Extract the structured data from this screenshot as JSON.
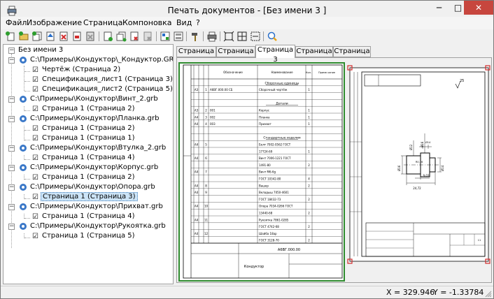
{
  "window": {
    "title": "Печать документов - [Без имени 3 ]"
  },
  "menu": [
    "Файл",
    "Изображение",
    "Страница",
    "Компоновка",
    "Вид",
    "?"
  ],
  "tree": {
    "root": "Без имени 3",
    "files": [
      {
        "path": "C:\\Примеры\\Кондуктор\\_Кондуктор.GRB",
        "pages": [
          "Чертёж (Страница 2)",
          "Спецификация_лист1 (Страница 3)",
          "Спецификация_лист2 (Страница 5)"
        ]
      },
      {
        "path": "C:\\Примеры\\Кондуктор\\Винт_2.grb",
        "pages": [
          "Страница 1 (Страница 2)"
        ]
      },
      {
        "path": "C:\\Примеры\\Кондуктор\\Планка.grb",
        "pages": [
          "Страница 1 (Страница 2)",
          "Страница 1 (Страница 1)"
        ]
      },
      {
        "path": "C:\\Примеры\\Кондуктор\\Втулка_2.grb",
        "pages": [
          "Страница 1 (Страница 4)"
        ]
      },
      {
        "path": "C:\\Примеры\\Кондуктор\\Корпус.grb",
        "pages": [
          "Страница 1 (Страница 2)"
        ]
      },
      {
        "path": "C:\\Примеры\\Кондуктор\\Опора.grb",
        "pages": [
          "Страница 1 (Страница 3)"
        ]
      },
      {
        "path": "C:\\Примеры\\Кондуктор\\Прихват.grb",
        "pages": [
          "Страница 1 (Страница 4)"
        ]
      },
      {
        "path": "C:\\Примеры\\Кондуктор\\Рукоятка.grb",
        "pages": [
          "Страница 1 (Страница 5)"
        ]
      }
    ],
    "selected_label": "Страница 1 (Страница 3)"
  },
  "tabs": [
    "Страница 1",
    "Страница 2",
    "Страница 3",
    "Страница 4",
    "Страница 5"
  ],
  "active_tab": "Страница 3",
  "spec_sheet": {
    "headers": [
      "Обозначение",
      "Наименование",
      "Кол.",
      "Приме-чание"
    ],
    "sections": [
      "Сборочные единицы",
      "Детали",
      "Стандартные изделия"
    ],
    "rows": [
      {
        "f": "A3",
        "p": "1",
        "d": "А6ВГ.000.00 СБ",
        "n": "Сборочный чертёж",
        "q": "1"
      },
      {
        "f": "A3",
        "p": "2",
        "d": "001",
        "n": "Корпус",
        "q": "1"
      },
      {
        "f": "A4",
        "p": "3",
        "d": "002",
        "n": "Планка",
        "q": "1"
      },
      {
        "f": "A4",
        "p": "4",
        "d": "003",
        "n": "Прихват",
        "q": "1"
      },
      {
        "f": "A4",
        "p": "5",
        "d": "",
        "n": "Болт 7002-0562 ГОСТ",
        "q": ""
      },
      {
        "f": "",
        "p": "",
        "d": "",
        "n": "17724-69",
        "q": "1"
      },
      {
        "f": "A4",
        "p": "6",
        "d": "",
        "n": "Винт 7006-1221 ГОСТ",
        "q": ""
      },
      {
        "f": "",
        "p": "",
        "d": "",
        "n": "1491-80",
        "q": "2"
      },
      {
        "f": "A4",
        "p": "7",
        "d": "",
        "n": "Винт М6-6g",
        "q": ""
      },
      {
        "f": "",
        "p": "",
        "d": "",
        "n": "ГОСТ 10342-80",
        "q": "4"
      },
      {
        "f": "A4",
        "p": "8",
        "d": "",
        "n": "Вашер",
        "q": "2"
      },
      {
        "f": "A4",
        "p": "9",
        "d": "",
        "n": "Вкладыш 7050-4601",
        "q": ""
      },
      {
        "f": "",
        "p": "",
        "d": "",
        "n": "ГОСТ 18432-73",
        "q": "2"
      },
      {
        "f": "A4",
        "p": "10",
        "d": "",
        "n": "Опора 7034-0266 ГОСТ",
        "q": ""
      },
      {
        "f": "",
        "p": "",
        "d": "",
        "n": "13440-68",
        "q": "2"
      },
      {
        "f": "A4",
        "p": "11",
        "d": "",
        "n": "Рукоятка 7861-0285",
        "q": ""
      },
      {
        "f": "",
        "p": "",
        "d": "",
        "n": "ГОСТ 4742-68",
        "q": "2"
      },
      {
        "f": "A4",
        "p": "12",
        "d": "",
        "n": "Шайба 18ар",
        "q": ""
      },
      {
        "f": "",
        "p": "",
        "d": "",
        "n": "ГОСТ 3128-70",
        "q": "2"
      }
    ],
    "title_code": "А6ВГ.000.00",
    "title_name": "Кондуктор"
  },
  "drawing": {
    "roughness": "25",
    "dims": [
      "Ø12",
      "Ø16",
      "Ø16",
      "Ø14",
      "24,72",
      "9,03",
      "R0,16",
      "Ø14",
      "11"
    ]
  },
  "status": {
    "x": "X = 329.946",
    "y": "Y = -1.33784"
  }
}
